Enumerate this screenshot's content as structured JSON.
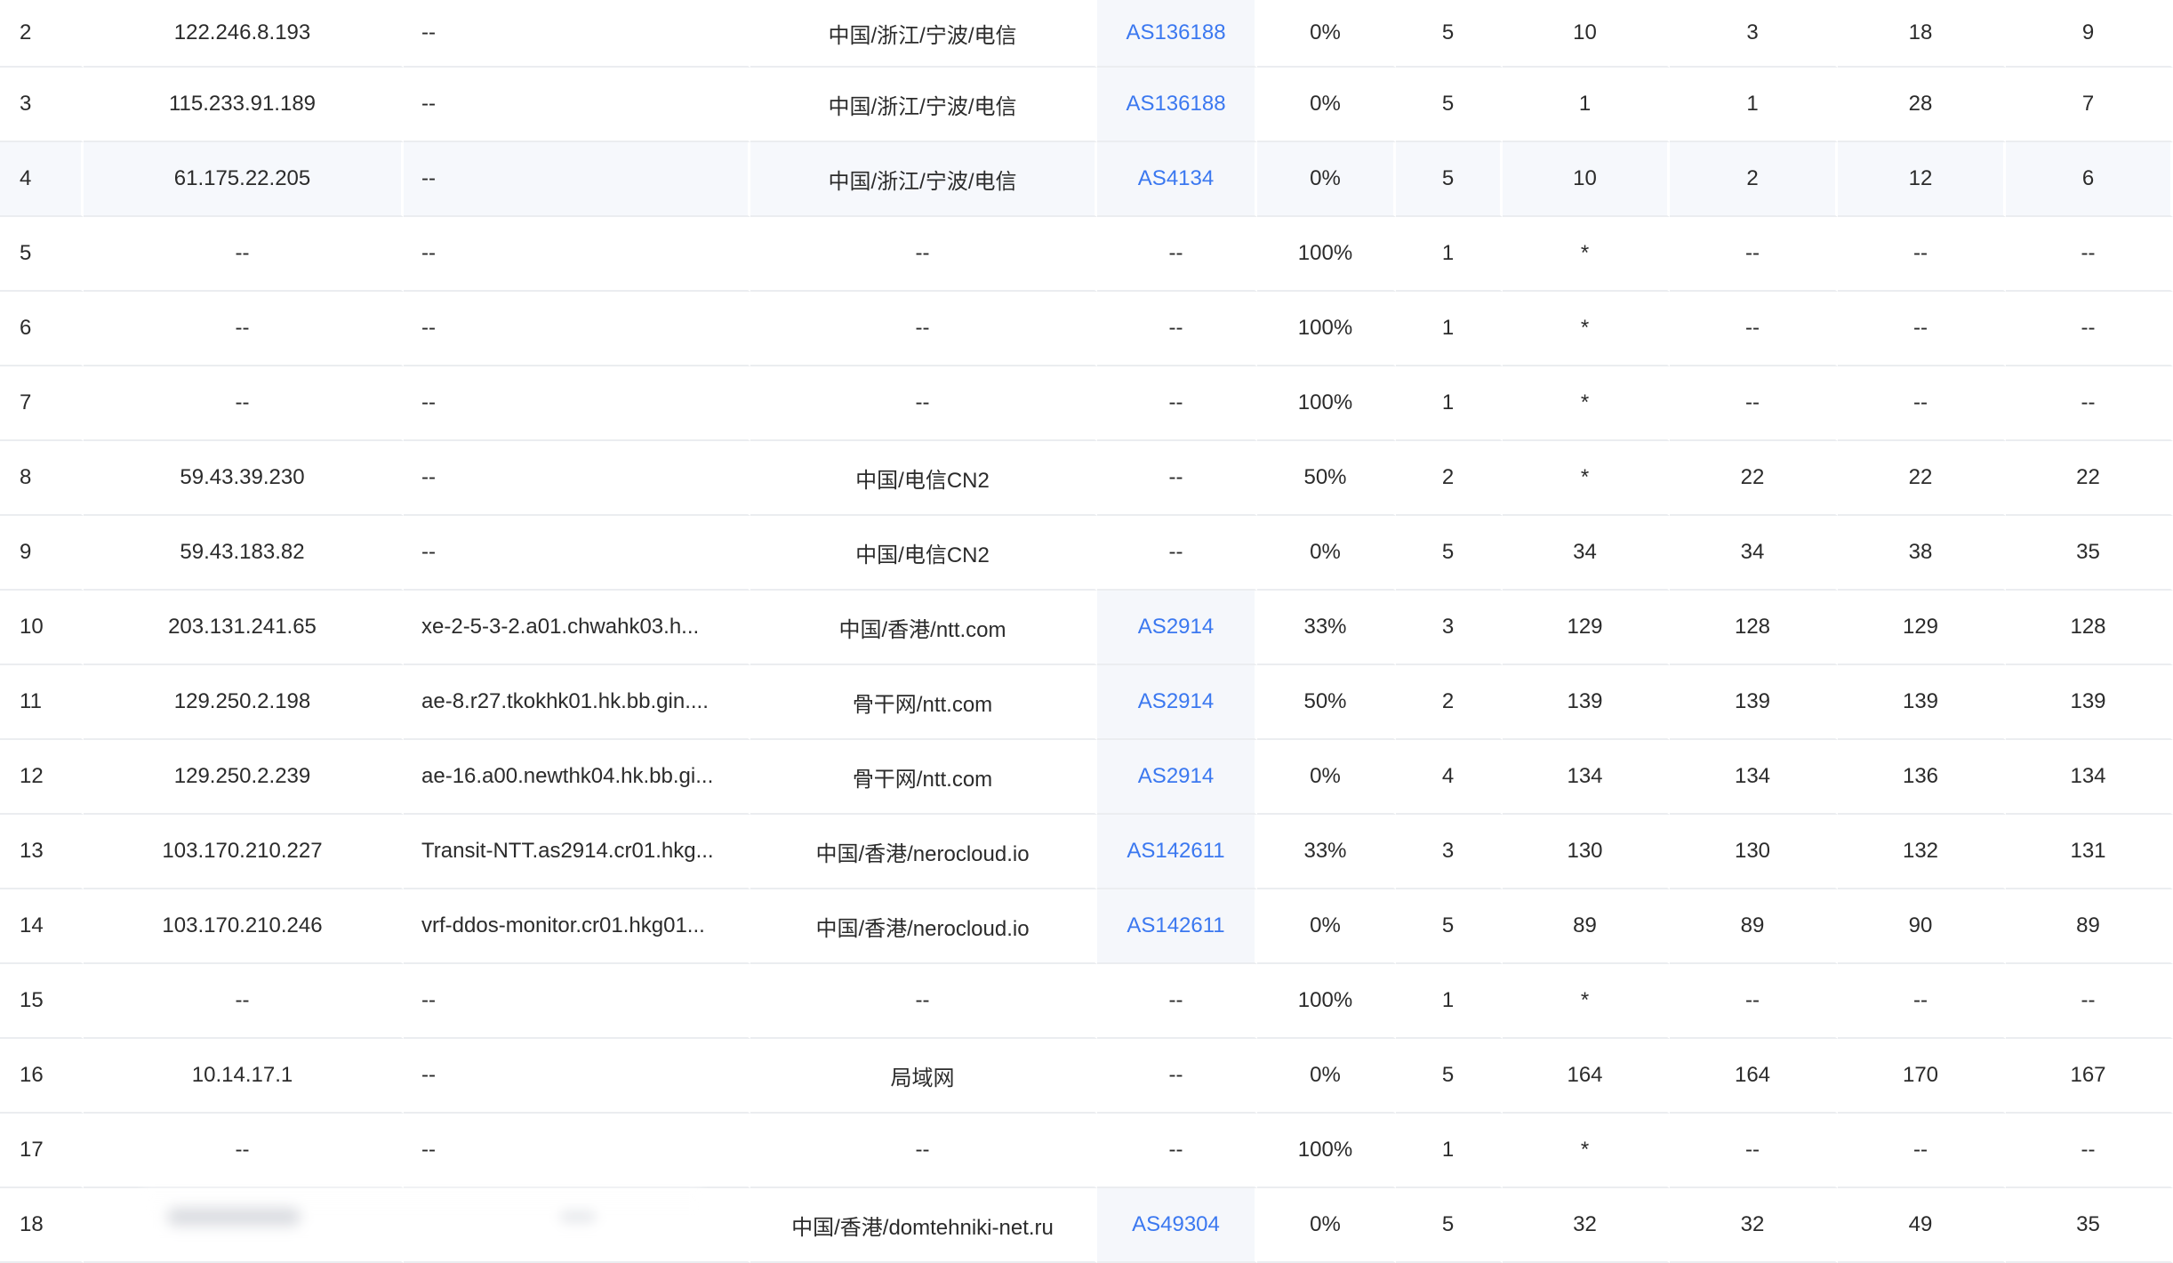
{
  "colors": {
    "link": "#3b78f0",
    "row_border": "#ebedf0",
    "highlight_row": "#f6f8fc",
    "asn_cell_bg": "#f5f7fb",
    "text": "#2b2b2b"
  },
  "rows": [
    {
      "hop": "2",
      "ip": "122.246.8.193",
      "host": "--",
      "location": "中国/浙江/宁波/电信",
      "asn": "AS136188",
      "loss": "0%",
      "sent": "5",
      "last": "10",
      "best": "3",
      "worst": "18",
      "avg": "9"
    },
    {
      "hop": "3",
      "ip": "115.233.91.189",
      "host": "--",
      "location": "中国/浙江/宁波/电信",
      "asn": "AS136188",
      "loss": "0%",
      "sent": "5",
      "last": "1",
      "best": "1",
      "worst": "28",
      "avg": "7"
    },
    {
      "hop": "4",
      "ip": "61.175.22.205",
      "host": "--",
      "location": "中国/浙江/宁波/电信",
      "asn": "AS4134",
      "loss": "0%",
      "sent": "5",
      "last": "10",
      "best": "2",
      "worst": "12",
      "avg": "6"
    },
    {
      "hop": "5",
      "ip": "--",
      "host": "--",
      "location": "--",
      "asn": "--",
      "loss": "100%",
      "sent": "1",
      "last": "*",
      "best": "--",
      "worst": "--",
      "avg": "--"
    },
    {
      "hop": "6",
      "ip": "--",
      "host": "--",
      "location": "--",
      "asn": "--",
      "loss": "100%",
      "sent": "1",
      "last": "*",
      "best": "--",
      "worst": "--",
      "avg": "--"
    },
    {
      "hop": "7",
      "ip": "--",
      "host": "--",
      "location": "--",
      "asn": "--",
      "loss": "100%",
      "sent": "1",
      "last": "*",
      "best": "--",
      "worst": "--",
      "avg": "--"
    },
    {
      "hop": "8",
      "ip": "59.43.39.230",
      "host": "--",
      "location": "中国/电信CN2",
      "asn": "--",
      "loss": "50%",
      "sent": "2",
      "last": "*",
      "best": "22",
      "worst": "22",
      "avg": "22"
    },
    {
      "hop": "9",
      "ip": "59.43.183.82",
      "host": "--",
      "location": "中国/电信CN2",
      "asn": "--",
      "loss": "0%",
      "sent": "5",
      "last": "34",
      "best": "34",
      "worst": "38",
      "avg": "35"
    },
    {
      "hop": "10",
      "ip": "203.131.241.65",
      "host": "xe-2-5-3-2.a01.chwahk03.h...",
      "location": "中国/香港/ntt.com",
      "asn": "AS2914",
      "loss": "33%",
      "sent": "3",
      "last": "129",
      "best": "128",
      "worst": "129",
      "avg": "128"
    },
    {
      "hop": "11",
      "ip": "129.250.2.198",
      "host": "ae-8.r27.tkokhk01.hk.bb.gin....",
      "location": "骨干网/ntt.com",
      "asn": "AS2914",
      "loss": "50%",
      "sent": "2",
      "last": "139",
      "best": "139",
      "worst": "139",
      "avg": "139"
    },
    {
      "hop": "12",
      "ip": "129.250.2.239",
      "host": "ae-16.a00.newthk04.hk.bb.gi...",
      "location": "骨干网/ntt.com",
      "asn": "AS2914",
      "loss": "0%",
      "sent": "4",
      "last": "134",
      "best": "134",
      "worst": "136",
      "avg": "134"
    },
    {
      "hop": "13",
      "ip": "103.170.210.227",
      "host": "Transit-NTT.as2914.cr01.hkg...",
      "location": "中国/香港/nerocloud.io",
      "asn": "AS142611",
      "loss": "33%",
      "sent": "3",
      "last": "130",
      "best": "130",
      "worst": "132",
      "avg": "131"
    },
    {
      "hop": "14",
      "ip": "103.170.210.246",
      "host": "vrf-ddos-monitor.cr01.hkg01...",
      "location": "中国/香港/nerocloud.io",
      "asn": "AS142611",
      "loss": "0%",
      "sent": "5",
      "last": "89",
      "best": "89",
      "worst": "90",
      "avg": "89"
    },
    {
      "hop": "15",
      "ip": "--",
      "host": "--",
      "location": "--",
      "asn": "--",
      "loss": "100%",
      "sent": "1",
      "last": "*",
      "best": "--",
      "worst": "--",
      "avg": "--"
    },
    {
      "hop": "16",
      "ip": "10.14.17.1",
      "host": "--",
      "location": "局域网",
      "asn": "--",
      "loss": "0%",
      "sent": "5",
      "last": "164",
      "best": "164",
      "worst": "170",
      "avg": "167"
    },
    {
      "hop": "17",
      "ip": "--",
      "host": "--",
      "location": "--",
      "asn": "--",
      "loss": "100%",
      "sent": "1",
      "last": "*",
      "best": "--",
      "worst": "--",
      "avg": "--"
    },
    {
      "hop": "18",
      "ip": "",
      "host": "",
      "location": "中国/香港/domtehniki-net.ru",
      "asn": "AS49304",
      "loss": "0%",
      "sent": "5",
      "last": "32",
      "best": "32",
      "worst": "49",
      "avg": "35"
    }
  ]
}
